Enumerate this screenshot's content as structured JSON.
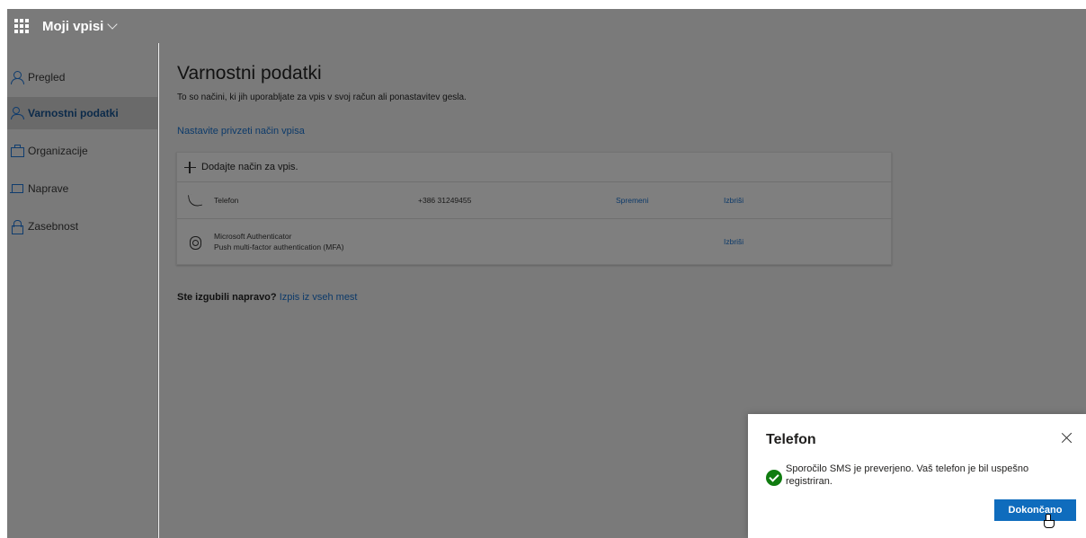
{
  "app": {
    "title": "Moji vpisi"
  },
  "sidebar": {
    "items": [
      {
        "label": "Pregled",
        "active": false,
        "icon": "person-icon"
      },
      {
        "label": "Varnostni podatki",
        "active": true,
        "icon": "key-person-icon"
      },
      {
        "label": "Organizacije",
        "active": false,
        "icon": "briefcase-icon"
      },
      {
        "label": "Naprave",
        "active": false,
        "icon": "laptop-icon"
      },
      {
        "label": "Zasebnost",
        "active": false,
        "icon": "lock-icon"
      }
    ]
  },
  "main": {
    "title": "Varnostni podatki",
    "subtitle": "To so načini, ki jih uporabljate za vpis v svoj račun ali ponastavitev gesla.",
    "default_link": "Nastavite privzeti način vpisa",
    "add_method": "Dodajte način za vpis.",
    "methods": [
      {
        "name": "Telefon",
        "value": "+386 31249455",
        "change": "Spremeni",
        "delete": "Izbriši",
        "icon": "phone-icon"
      },
      {
        "name": "Microsoft Authenticator",
        "detail": "Push multi-factor authentication (MFA)",
        "delete": "Izbriši",
        "icon": "authenticator-icon"
      }
    ],
    "lost_device_text": "Ste izgubili napravo?",
    "lost_device_link": "Izpis iz vseh mest"
  },
  "dialog": {
    "title": "Telefon",
    "message": "Sporočilo SMS je preverjeno. Vaš telefon je bil uspešno registriran.",
    "done_label": "Dokončano"
  },
  "colors": {
    "overlay": "#7a7a7a",
    "link": "#0c3a6a",
    "primary_button": "#0f6cbd",
    "success": "#107c10"
  }
}
